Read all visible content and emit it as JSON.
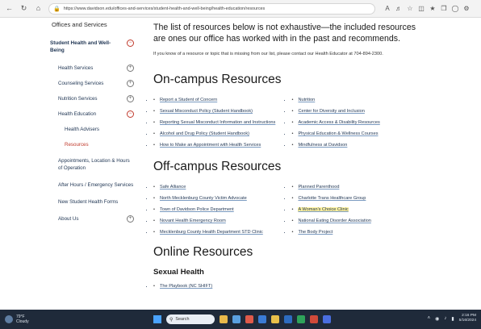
{
  "browser": {
    "url": "https://www.davidson.edu/offices-and-services/student-health-and-well-being/health-education/resources",
    "toolbar_icons": [
      "font-size-icon",
      "read-aloud-icon",
      "favorite-icon",
      "split-screen-icon",
      "favorites-bar-icon",
      "collections-icon",
      "profile-icon",
      "extensions-icon"
    ]
  },
  "sidebar": {
    "title": "Offices and Services",
    "head_label": "Student Health and Well-Being",
    "items": [
      {
        "label": "Health Services"
      },
      {
        "label": "Counseling Services"
      },
      {
        "label": "Nutrition Services"
      },
      {
        "label": "Health Education"
      }
    ],
    "sub_items": [
      {
        "label": "Health Advisers"
      },
      {
        "label": "Resources"
      }
    ],
    "plain": [
      {
        "label": "Appointments, Location & Hours of Operation"
      },
      {
        "label": "After Hours / Emergency Services"
      },
      {
        "label": "New Student Health Forms"
      },
      {
        "label": "About Us"
      }
    ]
  },
  "main": {
    "intro": "The list of resources below is not exhaustive—the included resources are ones our office has worked with in the past and recommends.",
    "note": "If you know of a resource or topic that is missing from our list, please contact our Health Educator at 704-894-2300.",
    "on_campus": {
      "title": "On-campus Resources",
      "left": [
        "Report a Student of Concern",
        "Sexual Misconduct Policy (Student Handbook)",
        "Reporting Sexual Misconduct Information and Instructions",
        "Alcohol and Drug Policy (Student Handbook)",
        "How to Make an Appointment with Health Services"
      ],
      "right": [
        "Nutrition",
        "Center for Diversity and Inclusion",
        "Academic Access & Disability Resources",
        "Physical Education & Wellness Courses",
        "Mindfulness at Davidson"
      ]
    },
    "off_campus": {
      "title": "Off-campus Resources",
      "left": [
        "Safe Alliance",
        "North Mecklenburg County Victim Advocate",
        "Town of Davidson Police Department",
        "Novant Health Emergency Room",
        "Mecklenburg County Health Department STD Clinic"
      ],
      "right": [
        "Planned Parenthood",
        "Charlotte Trans Healthcare Group",
        "A Woman's Choice Clinic",
        "National Eating Disorder Association",
        "The Body Project"
      ]
    },
    "online": {
      "title": "Online Resources",
      "subtitle": "Sexual Health",
      "items": [
        "The Playbook (NC SHIFT)"
      ]
    }
  },
  "taskbar": {
    "weather_temp": "79°F",
    "weather_desc": "Cloudy",
    "search_label": "Search",
    "time": "2:16 PM",
    "date": "5/16/2024"
  },
  "colors": {
    "link": "#1f3553",
    "accent": "#c0392b",
    "highlight": "#fff3a0",
    "taskbar": "#1f2a3a"
  }
}
